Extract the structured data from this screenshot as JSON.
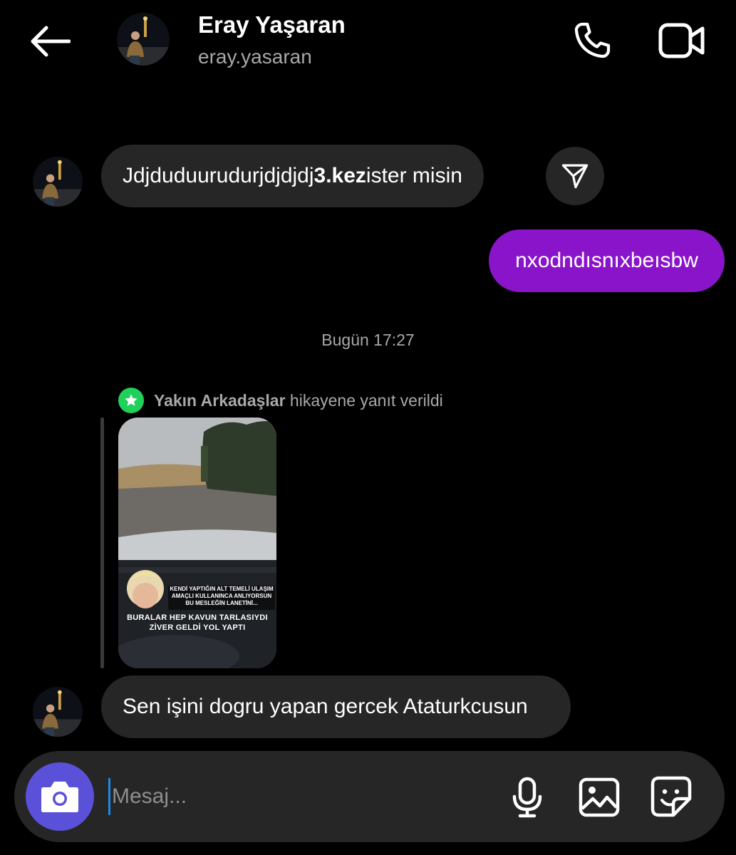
{
  "header": {
    "name": "Eray Yaşaran",
    "username": "eray.yasaran"
  },
  "messages": [
    {
      "from": "them",
      "parts": [
        "Jdjduduurudurjdjdjdj ",
        "3.kez",
        " ister misin"
      ]
    },
    {
      "from": "me",
      "text": "nxodndısnıxbeısbw"
    }
  ],
  "timestamp": "Bugün 17:27",
  "story_reply": {
    "audience": "Yakın Arkadaşlar",
    "action": " hikayene yanıt verildi",
    "caption_small": "KENDİ YAPTIĞIN ALT TEMELİ ULAŞIM AMAÇLI KULLANINCA ANLIYORSUN BU MESLEĞİN LANETİNİ...",
    "caption_big": "BURALAR HEP KAVUN TARLASIYDI ZİVER GELDİ YOL YAPTI"
  },
  "last_message": "Sen işini dogru yapan gercek Ataturkcusun",
  "composer": {
    "placeholder": "Mesaj..."
  },
  "colors": {
    "outgoing_bubble": "#8a14c9",
    "incoming_bubble": "#262626",
    "camera_button": "#5b51d8",
    "close_friends_badge": "#1fd15a"
  },
  "icons": [
    "back-arrow-icon",
    "phone-icon",
    "video-camera-icon",
    "send-paper-plane-icon",
    "star-icon",
    "camera-icon",
    "microphone-icon",
    "image-icon",
    "sticker-icon"
  ]
}
